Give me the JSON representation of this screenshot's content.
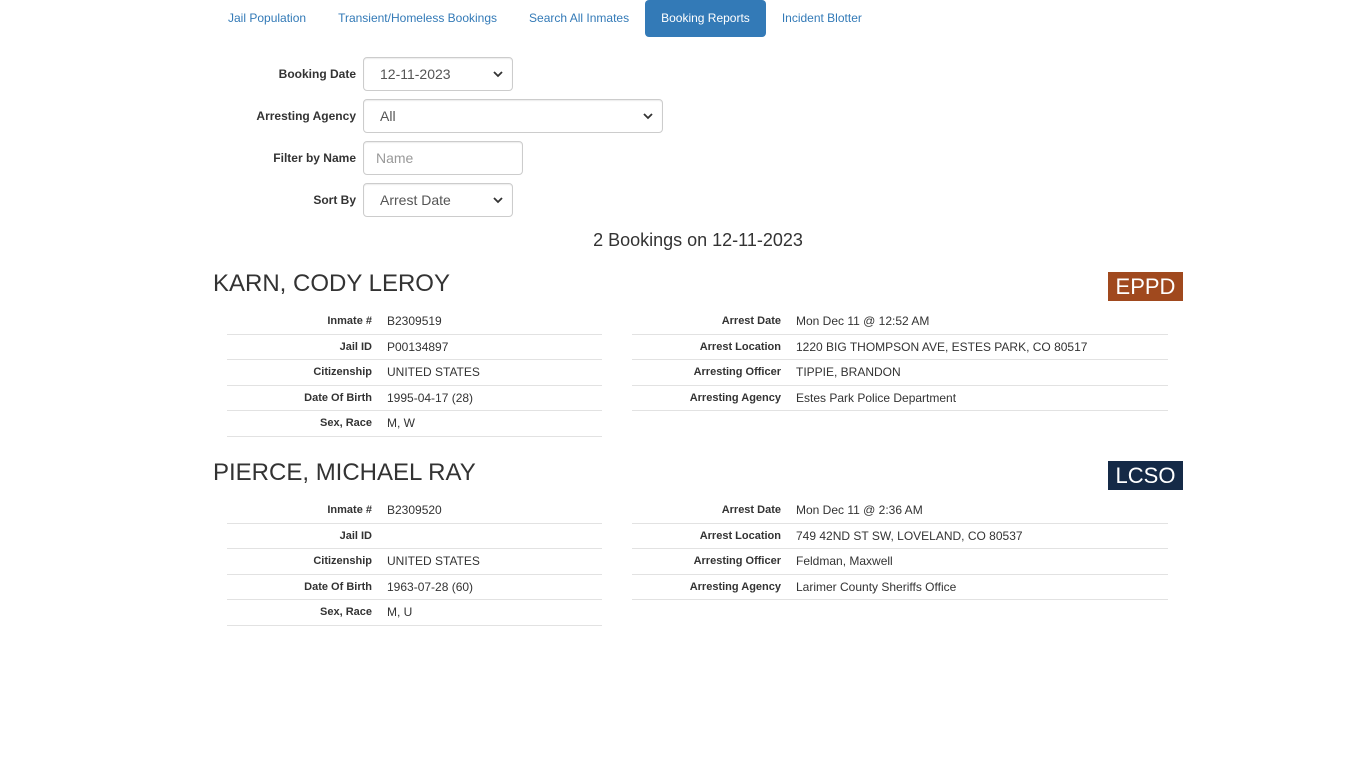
{
  "nav": {
    "tabs": [
      {
        "label": "Jail Population"
      },
      {
        "label": "Transient/Homeless Bookings"
      },
      {
        "label": "Search All Inmates"
      },
      {
        "label": "Booking Reports"
      },
      {
        "label": "Incident Blotter"
      }
    ],
    "active_index": 3
  },
  "form": {
    "booking_date": {
      "label": "Booking Date",
      "value": "12-11-2023"
    },
    "arresting_agency": {
      "label": "Arresting Agency",
      "value": "All"
    },
    "filter_name": {
      "label": "Filter by Name",
      "placeholder": "Name",
      "value": ""
    },
    "sort_by": {
      "label": "Sort By",
      "value": "Arrest Date"
    }
  },
  "summary": "2 Bookings on 12-11-2023",
  "bookings": [
    {
      "name": "KARN, CODY LEROY",
      "agency_badge": "EPPD",
      "badge_color": "#a0491e",
      "left": [
        {
          "key": "Inmate #",
          "value": "B2309519"
        },
        {
          "key": "Jail ID",
          "value": "P00134897"
        },
        {
          "key": "Citizenship",
          "value": "UNITED STATES"
        },
        {
          "key": "Date Of Birth",
          "value": "1995-04-17 (28)"
        },
        {
          "key": "Sex, Race",
          "value": "M, W"
        }
      ],
      "right": [
        {
          "key": "Arrest Date",
          "value": "Mon Dec 11 @ 12:52 AM"
        },
        {
          "key": "Arrest Location",
          "value": "1220 BIG THOMPSON AVE, ESTES PARK, CO 80517"
        },
        {
          "key": "Arresting Officer",
          "value": "TIPPIE, BRANDON"
        },
        {
          "key": "Arresting Agency",
          "value": "Estes Park Police Department"
        }
      ]
    },
    {
      "name": "PIERCE, MICHAEL RAY",
      "agency_badge": "LCSO",
      "badge_color": "#152a47",
      "left": [
        {
          "key": "Inmate #",
          "value": "B2309520"
        },
        {
          "key": "Jail ID",
          "value": ""
        },
        {
          "key": "Citizenship",
          "value": "UNITED STATES"
        },
        {
          "key": "Date Of Birth",
          "value": "1963-07-28 (60)"
        },
        {
          "key": "Sex, Race",
          "value": "M, U"
        }
      ],
      "right": [
        {
          "key": "Arrest Date",
          "value": "Mon Dec 11 @ 2:36 AM"
        },
        {
          "key": "Arrest Location",
          "value": "749 42ND ST SW, LOVELAND, CO 80537"
        },
        {
          "key": "Arresting Officer",
          "value": "Feldman, Maxwell"
        },
        {
          "key": "Arresting Agency",
          "value": "Larimer County Sheriffs Office"
        }
      ]
    }
  ],
  "icons": {
    "select_arrow": "chevron-down-icon"
  }
}
